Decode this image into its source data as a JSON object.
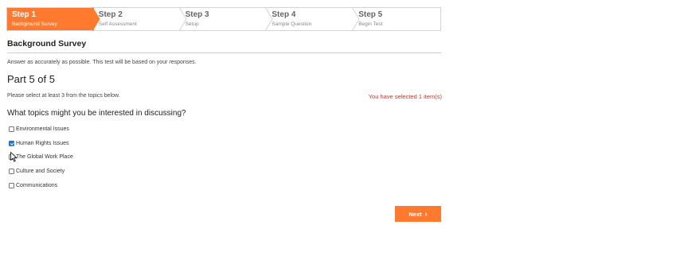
{
  "stepper": {
    "steps": [
      {
        "title": "Step 1",
        "subtitle": "Background Survey",
        "active": true
      },
      {
        "title": "Step 2",
        "subtitle": "Self Assessment",
        "active": false
      },
      {
        "title": "Step 3",
        "subtitle": "Setup",
        "active": false
      },
      {
        "title": "Step 4",
        "subtitle": "Sample Question",
        "active": false
      },
      {
        "title": "Step 5",
        "subtitle": "Begin Test",
        "active": false
      }
    ],
    "active_color": "#ff7a2f"
  },
  "survey": {
    "title": "Background Survey",
    "instructions": "Answer as accurately as possible. This test will be based on your responses.",
    "part_label": "Part 5 of 5",
    "select_hint": "Please select at least 3 from the topics below.",
    "selected_count_text": "You have selected 1 item(s)",
    "question": "What topics might you be interested in discussing?",
    "options": [
      {
        "label": "Environmental Issues",
        "checked": false
      },
      {
        "label": "Human Rights Issues",
        "checked": true
      },
      {
        "label": "The Global Work Place",
        "checked": false
      },
      {
        "label": "Culture and Society",
        "checked": false
      },
      {
        "label": "Communications",
        "checked": false
      }
    ]
  },
  "actions": {
    "next_label": "Next",
    "next_icon": "chevron-right-icon",
    "button_color": "#ff7a2f"
  },
  "cursor": {
    "icon": "mouse-pointer-icon"
  }
}
